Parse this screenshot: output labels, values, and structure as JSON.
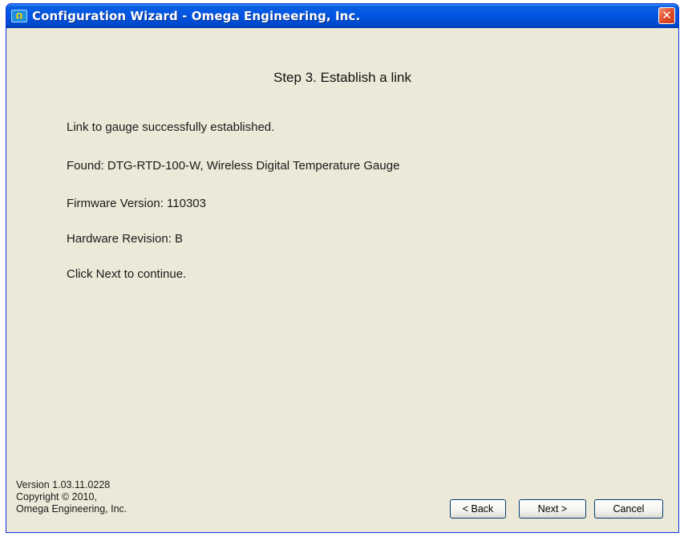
{
  "window": {
    "title": "Configuration Wizard - Omega Engineering, Inc.",
    "icon": "omega-app-icon",
    "close_glyph": "✕"
  },
  "step": {
    "title": "Step 3.  Establish a link"
  },
  "info": {
    "link_status": "Link to gauge successfully established.",
    "found": "Found:  DTG-RTD-100-W, Wireless Digital Temperature Gauge",
    "firmware": "Firmware Version:  110303",
    "hardware": "Hardware Revision:  B",
    "instruction": "Click Next to continue."
  },
  "footer": {
    "version": "Version 1.03.11.0228",
    "copyright": "Copyright © 2010,",
    "company": "Omega Engineering, Inc."
  },
  "buttons": {
    "back": "< Back",
    "next": "Next >",
    "cancel": "Cancel"
  },
  "colors": {
    "titlebar": "#0054e3",
    "window_bg": "#ece9d8",
    "close_button": "#e2502c"
  }
}
